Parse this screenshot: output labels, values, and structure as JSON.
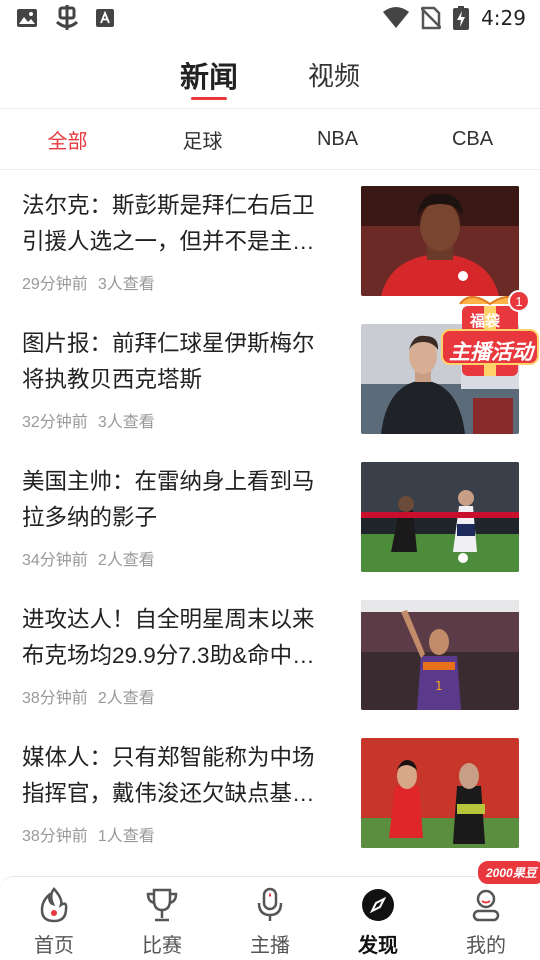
{
  "status_bar": {
    "time": "4:29",
    "left_icons": [
      "image-icon",
      "bug-icon",
      "font-icon"
    ],
    "right_icons": [
      "wifi-icon",
      "no-sim-icon",
      "battery-charging-icon"
    ]
  },
  "top_tabs": [
    {
      "label": "新闻",
      "active": true
    },
    {
      "label": "视频",
      "active": false
    }
  ],
  "category_tabs": [
    {
      "label": "全部",
      "active": true
    },
    {
      "label": "足球",
      "active": false
    },
    {
      "label": "NBA",
      "active": false
    },
    {
      "label": "CBA",
      "active": false
    }
  ],
  "news": [
    {
      "title": "法尔克：斯彭斯是拜仁右后卫引援人选之一，但并不是主…",
      "time": "29分钟前",
      "views": "3人查看",
      "thumb": "red-jersey-player"
    },
    {
      "title": "图片报：前拜仁球星伊斯梅尔将执教贝西克塔斯",
      "time": "32分钟前",
      "views": "3人查看",
      "thumb": "coach-stadium"
    },
    {
      "title": "美国主帅：在雷纳身上看到马拉多纳的影子",
      "time": "34分钟前",
      "views": "2人查看",
      "thumb": "soccer-match"
    },
    {
      "title": "进攻达人！自全明星周末以来布克场均29.9分7.3助&命中…",
      "time": "38分钟前",
      "views": "2人查看",
      "thumb": "basketball-player"
    },
    {
      "title": "媒体人：只有郑智能称为中场指挥官，戴伟浚还欠缺点基…",
      "time": "38分钟前",
      "views": "1人查看",
      "thumb": "china-training"
    }
  ],
  "promo": {
    "text": "主播活动",
    "sub_text": "福袋",
    "badge": "1"
  },
  "bottom_nav": [
    {
      "label": "首页",
      "icon": "flame-icon",
      "active": false
    },
    {
      "label": "比赛",
      "icon": "trophy-icon",
      "active": false
    },
    {
      "label": "主播",
      "icon": "microphone-icon",
      "active": false
    },
    {
      "label": "发现",
      "icon": "compass-icon",
      "active": true
    },
    {
      "label": "我的",
      "icon": "user-icon",
      "active": false,
      "badge": "2000果豆"
    }
  ],
  "colors": {
    "accent": "#e8383d",
    "meta_text": "#999999",
    "title_text": "#222222"
  }
}
